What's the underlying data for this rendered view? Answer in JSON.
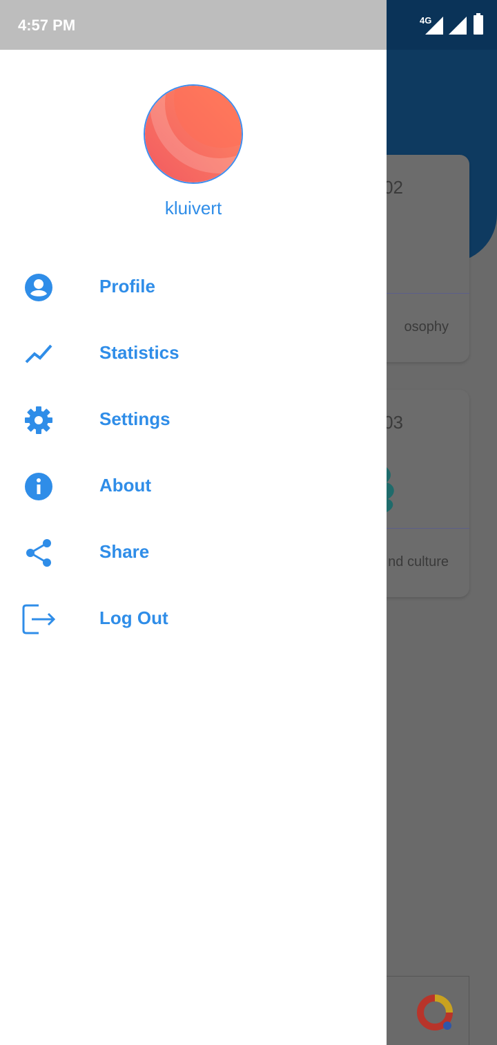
{
  "status_bar": {
    "time": "4:57 PM",
    "network_label": "4G",
    "icons": [
      "signal-4g-icon",
      "signal-icon",
      "battery-icon"
    ]
  },
  "drawer": {
    "username": "kluivert",
    "menu": [
      {
        "label": "Profile",
        "icon": "account-circle-icon"
      },
      {
        "label": "Statistics",
        "icon": "trending-up-icon"
      },
      {
        "label": "Settings",
        "icon": "gear-icon"
      },
      {
        "label": "About",
        "icon": "info-icon"
      },
      {
        "label": "Share",
        "icon": "share-icon"
      },
      {
        "label": "Log Out",
        "icon": "logout-icon"
      }
    ]
  },
  "background": {
    "cards": [
      {
        "number_fragment": "02",
        "label_fragment": "osophy"
      },
      {
        "number_fragment": "03",
        "label_fragment": "nd culture"
      }
    ]
  },
  "colors": {
    "accent": "#2f8de8",
    "header_dark": "#0e3a60",
    "avatar": "#ff6f5e"
  }
}
